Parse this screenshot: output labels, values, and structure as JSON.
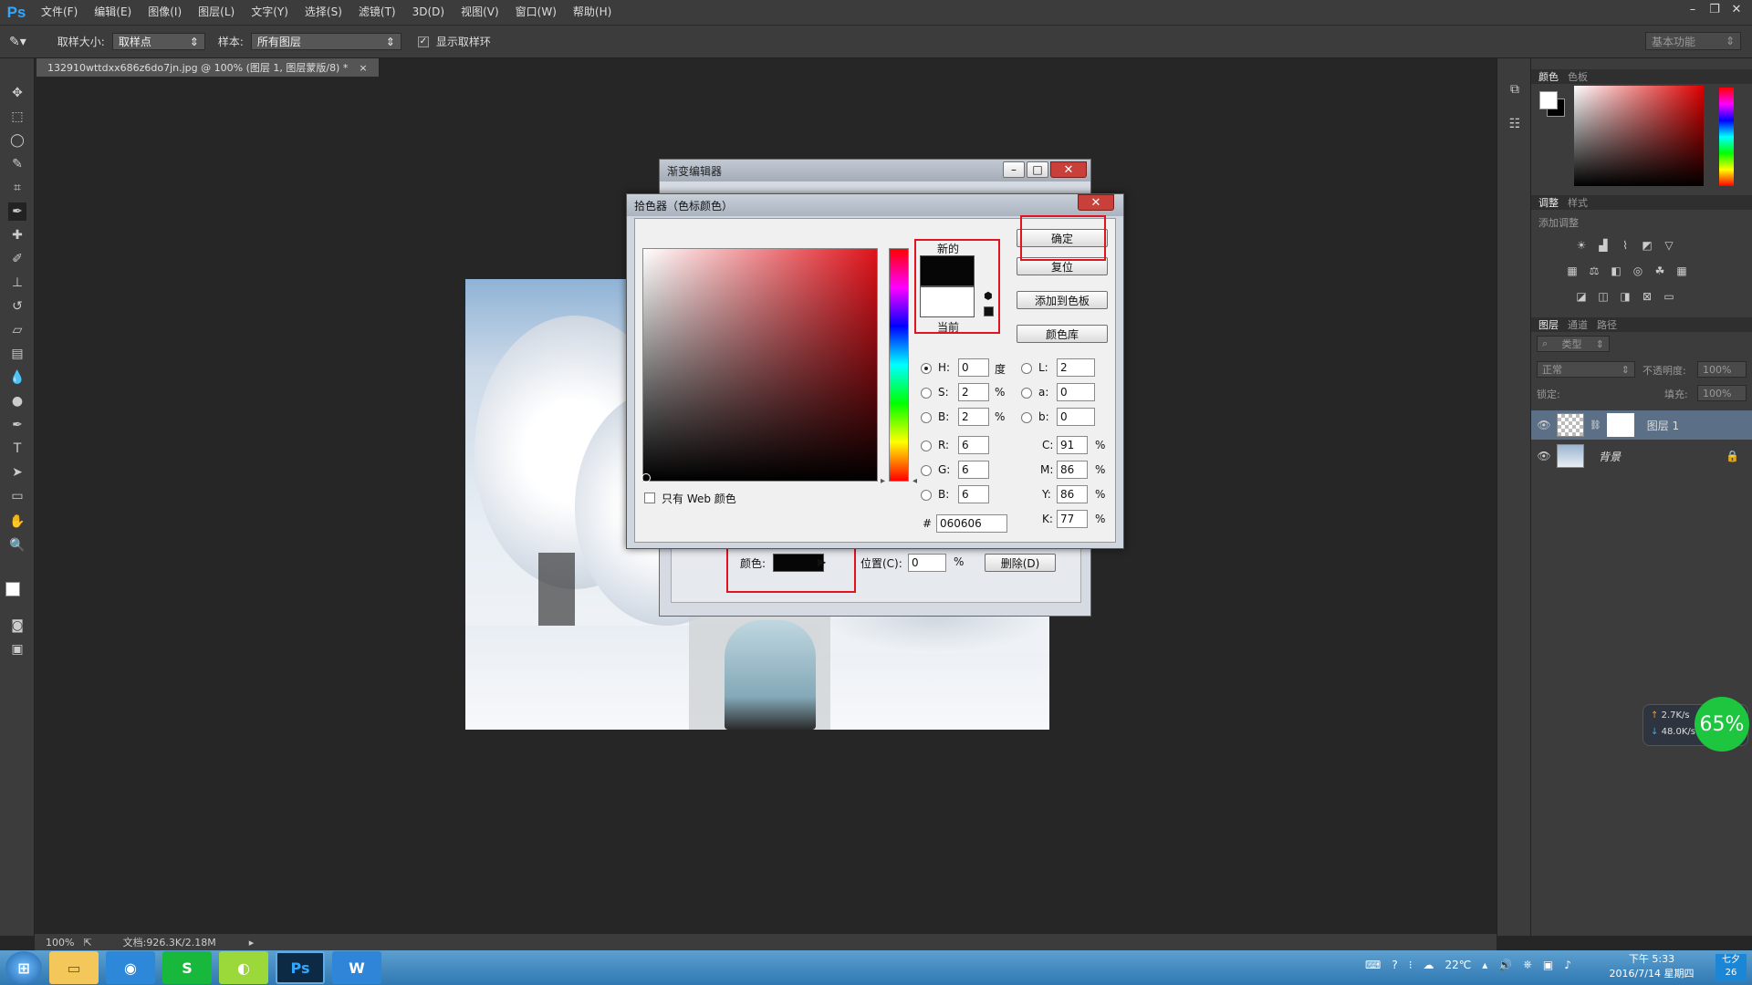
{
  "app": {
    "logo": "Ps"
  },
  "menu": [
    "文件(F)",
    "编辑(E)",
    "图像(I)",
    "图层(L)",
    "文字(Y)",
    "选择(S)",
    "滤镜(T)",
    "3D(D)",
    "视图(V)",
    "窗口(W)",
    "帮助(H)"
  ],
  "options": {
    "sample_size_label": "取样大小:",
    "sample_size_value": "取样点",
    "sample_label": "样本:",
    "sample_value": "所有图层",
    "show_ring_label": "显示取样环",
    "workspace": "基本功能"
  },
  "document": {
    "tab_title": "132910wttdxx686z6do7jn.jpg @ 100% (图层 1, 图层蒙版/8) *",
    "zoom": "100%",
    "doc_info": "文档:926.3K/2.18M"
  },
  "panels": {
    "color_tabs": [
      "颜色",
      "色板"
    ],
    "adjust_tabs": [
      "调整",
      "样式"
    ],
    "adjust_hint": "添加调整",
    "layer_tabs": [
      "图层",
      "通道",
      "路径"
    ],
    "kind_filter": "类型",
    "blend_mode": "正常",
    "opacity_label": "不透明度:",
    "opacity_value": "100%",
    "lock_label": "锁定:",
    "fill_label": "填充:",
    "fill_value": "100%",
    "layers": [
      {
        "name": "图层 1"
      },
      {
        "name": "背景"
      }
    ]
  },
  "net_widget": {
    "up": "2.7K/s",
    "down": "48.0K/s",
    "percent": "65%"
  },
  "gradient_editor": {
    "title": "渐变编辑器",
    "color_label": "颜色:",
    "location_label": "位置(C):",
    "location_value": "0",
    "percent": "%",
    "delete_button": "删除(D)"
  },
  "color_picker": {
    "title": "拾色器（色标颜色）",
    "new_label": "新的",
    "current_label": "当前",
    "ok_button": "确定",
    "reset_button": "复位",
    "add_swatch_button": "添加到色板",
    "libraries_button": "颜色库",
    "web_only_label": "只有 Web 颜色",
    "hsb": {
      "H": "0",
      "S": "2",
      "B": "2",
      "h_unit": "度",
      "s_unit": "%",
      "b_unit": "%"
    },
    "rgb": {
      "R": "6",
      "G": "6",
      "B": "6"
    },
    "lab": {
      "L": "2",
      "a": "0",
      "b": "0"
    },
    "cmyk": {
      "C": "91",
      "M": "86",
      "Y": "86",
      "K": "77"
    },
    "hex_label": "#",
    "hex": "060606",
    "new_color": "#060606",
    "current_color": "#ffffff"
  },
  "taskbar": {
    "apps": [
      "explorer",
      "ie",
      "wps-sheet",
      "browser",
      "photoshop",
      "wps-writer"
    ],
    "ps_label": "Ps",
    "s_label": "S",
    "w_label": "W",
    "temperature": "22℃",
    "time": "下午 5:33",
    "date": "2016/7/14 星期四",
    "badge_top": "七夕",
    "badge_day": "26"
  }
}
